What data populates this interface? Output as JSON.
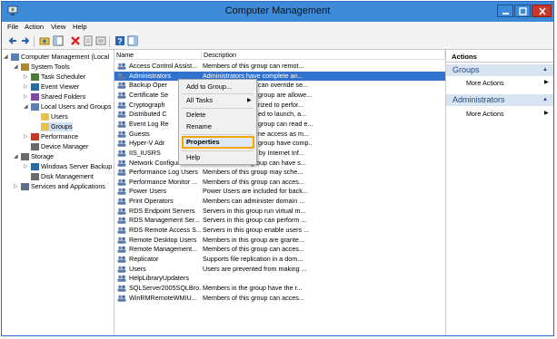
{
  "window": {
    "title": "Computer Management"
  },
  "menu": [
    "File",
    "Action",
    "View",
    "Help"
  ],
  "tree": [
    {
      "label": "Computer Management (Local",
      "indent": 0
    },
    {
      "label": "System Tools",
      "indent": 1
    },
    {
      "label": "Task Scheduler",
      "indent": 2
    },
    {
      "label": "Event Viewer",
      "indent": 2
    },
    {
      "label": "Shared Folders",
      "indent": 2
    },
    {
      "label": "Local Users and Groups",
      "indent": 2
    },
    {
      "label": "Users",
      "indent": 3
    },
    {
      "label": "Groups",
      "indent": 3
    },
    {
      "label": "Performance",
      "indent": 2
    },
    {
      "label": "Device Manager",
      "indent": 2
    },
    {
      "label": "Storage",
      "indent": 1
    },
    {
      "label": "Windows Server Backup",
      "indent": 2
    },
    {
      "label": "Disk Management",
      "indent": 2
    },
    {
      "label": "Services and Applications",
      "indent": 1
    }
  ],
  "columns": {
    "name": "Name",
    "description": "Description"
  },
  "rows": [
    {
      "name": "Access Control Assist...",
      "desc": "Members of this group can remot..."
    },
    {
      "name": "Administrators",
      "desc": "Administrators have complete an..."
    },
    {
      "name": "Backup Oper",
      "desc": "can override se..."
    },
    {
      "name": "Certificate Se",
      "desc": "group are allowe..."
    },
    {
      "name": "Cryptograph",
      "desc": "rized to perfor..."
    },
    {
      "name": "Distributed C",
      "desc": "ed to launch, a..."
    },
    {
      "name": "Event Log Re",
      "desc": "group can read e..."
    },
    {
      "name": "Guests",
      "desc": "ne access as m..."
    },
    {
      "name": "Hyper-V Adr",
      "desc": "group have comp..."
    },
    {
      "name": "IIS_IUSRS",
      "desc": "Built-in group used by Internet Inf..."
    },
    {
      "name": "Network Configuratio...",
      "desc": "Members in this group can have s..."
    },
    {
      "name": "Performance Log Users",
      "desc": "Members of this group may sche..."
    },
    {
      "name": "Performance Monitor ...",
      "desc": "Members of this group can acces..."
    },
    {
      "name": "Power Users",
      "desc": "Power Users are included for back..."
    },
    {
      "name": "Print Operators",
      "desc": "Members can administer domain ..."
    },
    {
      "name": "RDS Endpoint Servers",
      "desc": "Servers in this group run virtual m..."
    },
    {
      "name": "RDS Management Ser...",
      "desc": "Servers in this group can perform ..."
    },
    {
      "name": "RDS Remote Access S...",
      "desc": "Servers in this group enable users ..."
    },
    {
      "name": "Remote Desktop Users",
      "desc": "Members in this group are grante..."
    },
    {
      "name": "Remote Management...",
      "desc": "Members of this group can acces..."
    },
    {
      "name": "Replicator",
      "desc": "Supports file replication in a dom..."
    },
    {
      "name": "Users",
      "desc": "Users are prevented from making ..."
    },
    {
      "name": "HelpLibraryUpdaters",
      "desc": ""
    },
    {
      "name": "SQLServer2005SQLBro...",
      "desc": "Members in the group have the r..."
    },
    {
      "name": "WinRMRemoteWMIU...",
      "desc": "Members of this group can acces..."
    }
  ],
  "context_menu": {
    "add_to_group": "Add to Group...",
    "all_tasks": "All Tasks",
    "delete": "Delete",
    "rename": "Rename",
    "properties": "Properties",
    "help": "Help"
  },
  "actions": {
    "header": "Actions",
    "group1": "Groups",
    "more1": "More Actions",
    "group2": "Administrators",
    "more2": "More Actions"
  },
  "colors": {
    "titlebar": "#3c8ad8",
    "selection": "#2f73cf",
    "highlight_border": "#f0a800",
    "action_group_bg": "#d9e4f1"
  }
}
